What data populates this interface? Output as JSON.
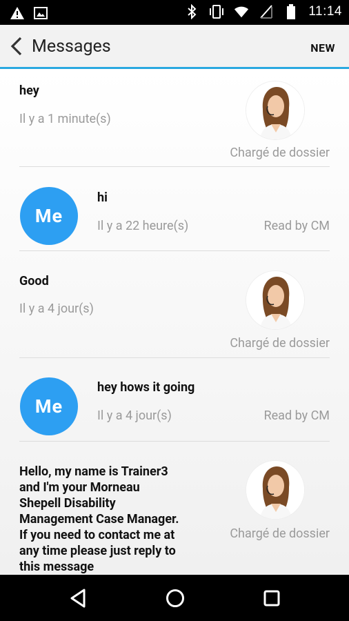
{
  "status_bar": {
    "time": "11:14",
    "left_icons": [
      "warning-icon",
      "image-icon"
    ],
    "right_icons": [
      "bluetooth-icon",
      "vibrate-icon",
      "wifi-icon",
      "no-sim-icon",
      "battery-icon"
    ]
  },
  "app_bar": {
    "title": "Messages",
    "new_label": "NEW",
    "accent_color": "#29a8e0"
  },
  "messages": [
    {
      "text": "hey",
      "time": "Il y a 1 minute(s)",
      "sender_label": "Chargé de dossier",
      "from_me": false
    },
    {
      "text": "hi",
      "time": "Il y a 22 heure(s)",
      "status": "Read by CM",
      "from_me": true,
      "avatar_label": "Me"
    },
    {
      "text": "Good",
      "time": "Il y a 4 jour(s)",
      "sender_label": "Chargé de dossier",
      "from_me": false
    },
    {
      "text": "hey hows it going",
      "time": "Il y a 4 jour(s)",
      "status": "Read by CM",
      "from_me": true,
      "avatar_label": "Me"
    },
    {
      "text": "Hello, my name is Trainer3\nand I'm your Morneau\nShepell Disability\nManagement Case Manager.\nIf you need to contact me at\nany time please just reply to\nthis message",
      "sender_label": "Chargé de dossier",
      "from_me": false
    }
  ],
  "colors": {
    "me_avatar": "#2d9ff2",
    "secondary_text": "#9a9a9a"
  },
  "nav_bar": {
    "buttons": [
      "back-triangle-icon",
      "home-circle-icon",
      "recents-square-icon"
    ]
  }
}
